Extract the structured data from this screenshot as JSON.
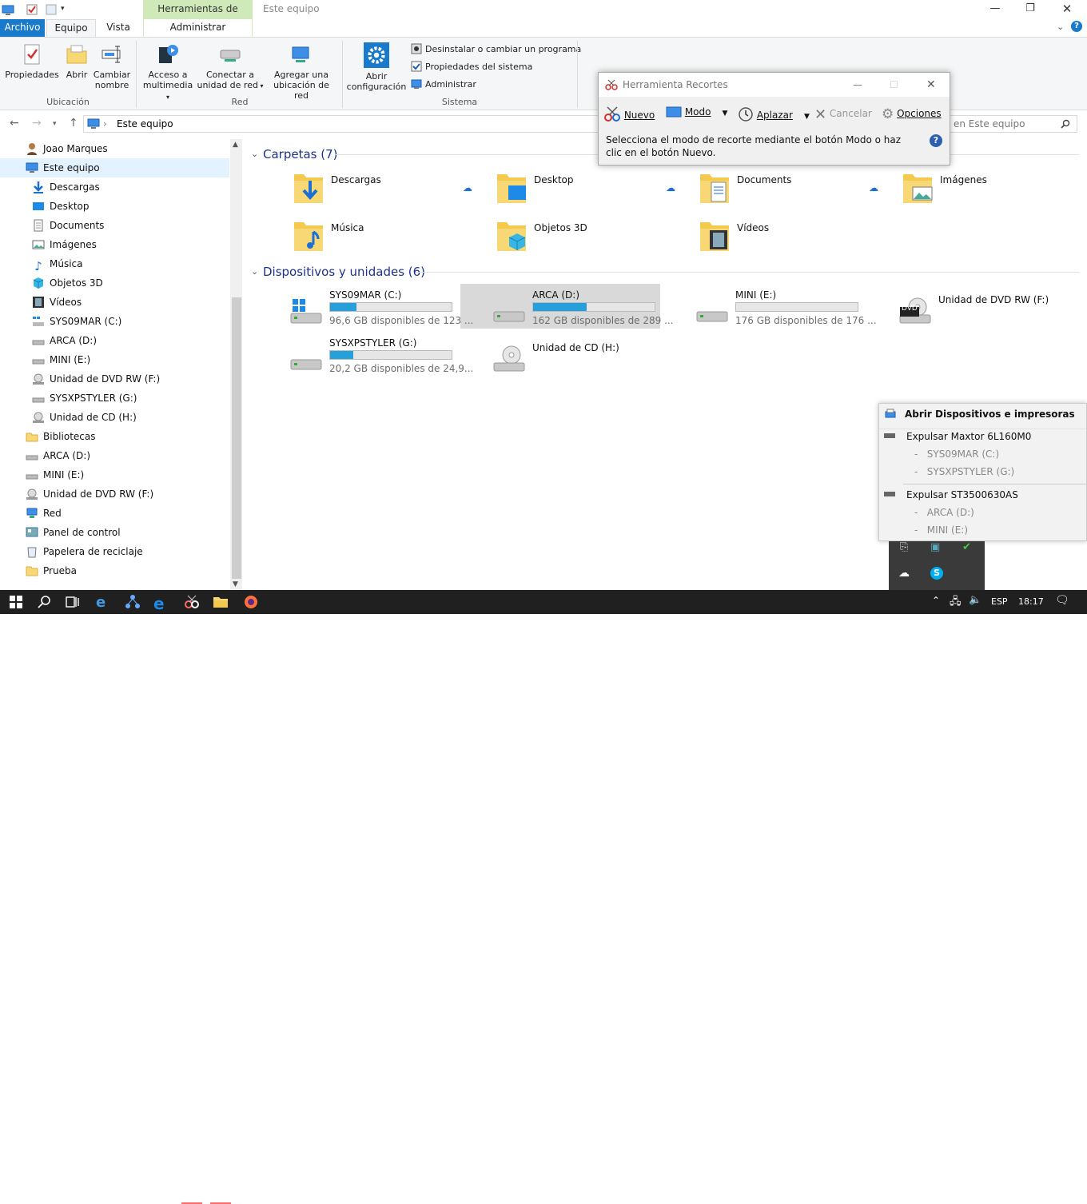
{
  "window": {
    "title": "Este equipo",
    "context_tab": "Herramientas de unidad",
    "minimize": "—",
    "restore": "❐",
    "close": "✕"
  },
  "ribbon_tabs": {
    "archivo": "Archivo",
    "equipo": "Equipo",
    "vista": "Vista",
    "administrar": "Administrar"
  },
  "ribbon": {
    "propiedades": "Propiedades",
    "abrir": "Abrir",
    "cambiar_nombre_1": "Cambiar",
    "cambiar_nombre_2": "nombre",
    "acceso_1": "Acceso a",
    "acceso_2": "multimedia",
    "conectar_1": "Conectar a",
    "conectar_2": "unidad de red",
    "agregar_1": "Agregar una",
    "agregar_2": "ubicación de red",
    "abrir_conf_1": "Abrir",
    "abrir_conf_2": "configuración",
    "desinstalar": "Desinstalar o cambiar un programa",
    "propiedades_sistema": "Propiedades del sistema",
    "administrar": "Administrar",
    "group_ubicacion": "Ubicación",
    "group_red": "Red",
    "group_sistema": "Sistema"
  },
  "address": {
    "path": "Este equipo",
    "search_placeholder": "Buscar en Este equipo",
    "search_visible": "en Este equipo"
  },
  "nav": {
    "items": [
      {
        "label": "Joao Marques"
      },
      {
        "label": "Este equipo"
      },
      {
        "label": "Descargas"
      },
      {
        "label": "Desktop"
      },
      {
        "label": "Documents"
      },
      {
        "label": "Imágenes"
      },
      {
        "label": "Música"
      },
      {
        "label": "Objetos 3D"
      },
      {
        "label": "Vídeos"
      },
      {
        "label": "SYS09MAR (C:)"
      },
      {
        "label": "ARCA (D:)"
      },
      {
        "label": "MINI (E:)"
      },
      {
        "label": "Unidad de DVD RW (F:)"
      },
      {
        "label": "SYSXPSTYLER (G:)"
      },
      {
        "label": "Unidad de CD (H:)"
      },
      {
        "label": "Bibliotecas"
      },
      {
        "label": "ARCA (D:)"
      },
      {
        "label": "MINI (E:)"
      },
      {
        "label": "Unidad de DVD RW (F:)"
      },
      {
        "label": "Red"
      },
      {
        "label": "Panel de control"
      },
      {
        "label": "Papelera de reciclaje"
      },
      {
        "label": "Prueba"
      }
    ]
  },
  "content": {
    "folders_header": "Carpetas (7)",
    "devices_header": "Dispositivos y unidades (6)",
    "folders": [
      {
        "label": "Descargas"
      },
      {
        "label": "Desktop"
      },
      {
        "label": "Documents"
      },
      {
        "label": "Imágenes"
      },
      {
        "label": "Música"
      },
      {
        "label": "Objetos 3D"
      },
      {
        "label": "Vídeos"
      }
    ],
    "drives": [
      {
        "label": "SYS09MAR (C:)",
        "space": "96,6 GB disponibles de 123 ...",
        "used_fraction": 0.22
      },
      {
        "label": "ARCA (D:)",
        "space": "162 GB disponibles de 289 ...",
        "used_fraction": 0.44
      },
      {
        "label": "MINI (E:)",
        "space": "176 GB disponibles de 176 ...",
        "used_fraction": 0.0
      },
      {
        "label": "Unidad de DVD RW (F:)"
      },
      {
        "label": "SYSXPSTYLER (G:)",
        "space": "20,2 GB disponibles de 24,9...",
        "used_fraction": 0.19
      },
      {
        "label": "Unidad de CD (H:)"
      }
    ],
    "dvd_badge": "DVD"
  },
  "snipping": {
    "title": "Herramienta Recortes",
    "nuevo": "Nuevo",
    "modo": "Modo",
    "aplazar": "Aplazar",
    "cancelar": "Cancelar",
    "opciones": "Opciones",
    "message": "Selecciona el modo de recorte mediante el botón Modo o haz clic en el botón Nuevo.",
    "help": "?"
  },
  "popup": {
    "open_devices": "Abrir Dispositivos e impresoras",
    "eject1": "Expulsar Maxtor 6L160M0",
    "eject1_a": "SYS09MAR (C:)",
    "eject1_b": "SYSXPSTYLER (G:)",
    "eject2": "Expulsar ST3500630AS",
    "eject2_a": "ARCA (D:)",
    "eject2_b": "MINI (E:)",
    "dash": "-"
  },
  "taskbar": {
    "lang": "ESP",
    "time": "18:17"
  },
  "colors": {
    "accent": "#1979ca",
    "drive_bar": "#26a0da",
    "context_tab": "#cfe9b8",
    "section_header": "#1e3287",
    "taskbar": "#202020"
  }
}
